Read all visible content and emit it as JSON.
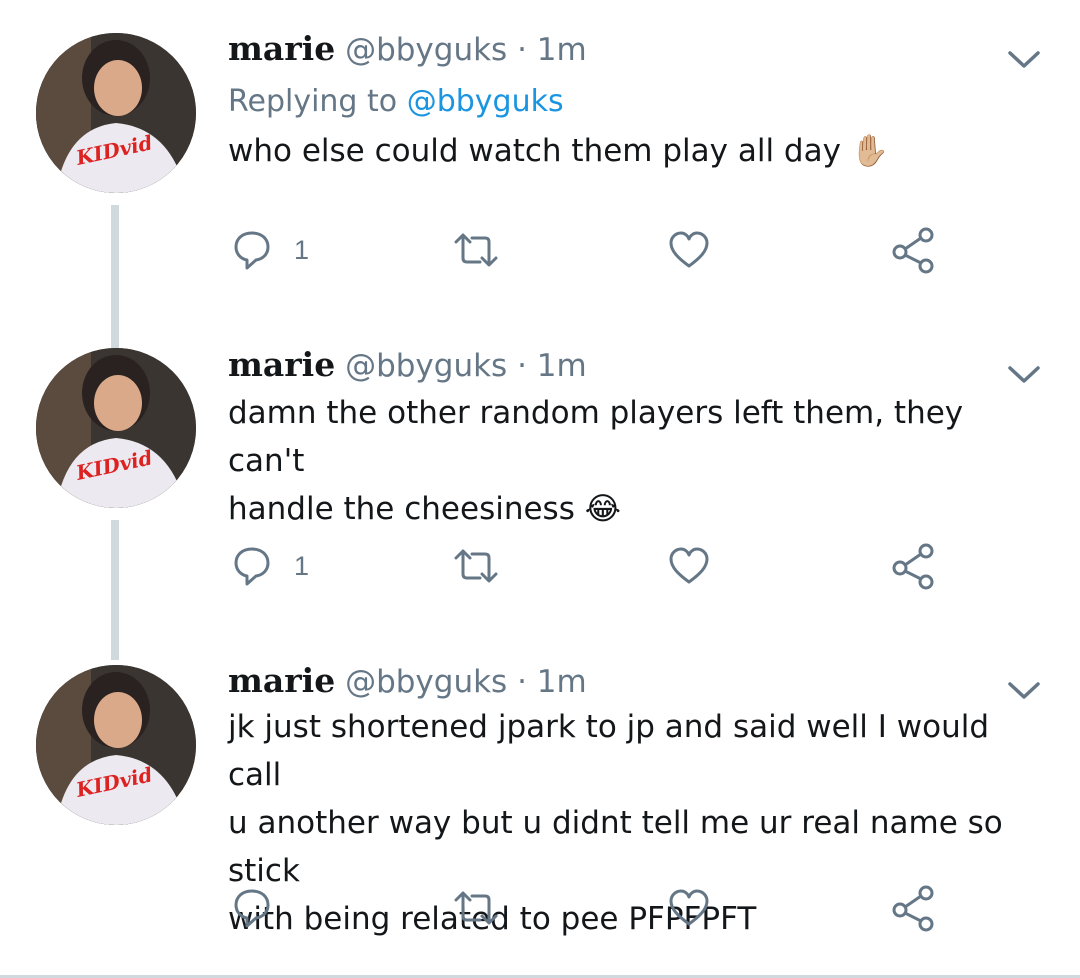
{
  "tweets": [
    {
      "name": "marie",
      "handle": "@bbyguks",
      "separator": "·",
      "time": "1m",
      "replying_label": "Replying to",
      "replying_handle": "@bbyguks",
      "text": "who else could watch them play all day",
      "emoji": "✋🏼",
      "reply_count": "1"
    },
    {
      "name": "marie",
      "handle": "@bbyguks",
      "separator": "·",
      "time": "1m",
      "text_line1": "damn the other random players left them, they can't",
      "text_line2": "handle the cheesiness",
      "emoji": "😂",
      "reply_count": "1"
    },
    {
      "name": "marie",
      "handle": "@bbyguks",
      "separator": "·",
      "time": "1m",
      "text_line1": "jk just shortened jpark to jp and said well I would call",
      "text_line2": "u another way but u didnt tell me ur real name so stick",
      "text_line3": "with being related to pee PFPFPFT",
      "reply_count": ""
    }
  ],
  "avatar_shirt_text": "KIDvid",
  "colors": {
    "text": "#14171a",
    "secondary": "#657786",
    "link": "#1b95e0",
    "thread_line": "#cfd9de",
    "icon": "#657786"
  },
  "icons": [
    "reply-icon",
    "retweet-icon",
    "like-icon",
    "share-icon",
    "chevron-down-icon"
  ]
}
